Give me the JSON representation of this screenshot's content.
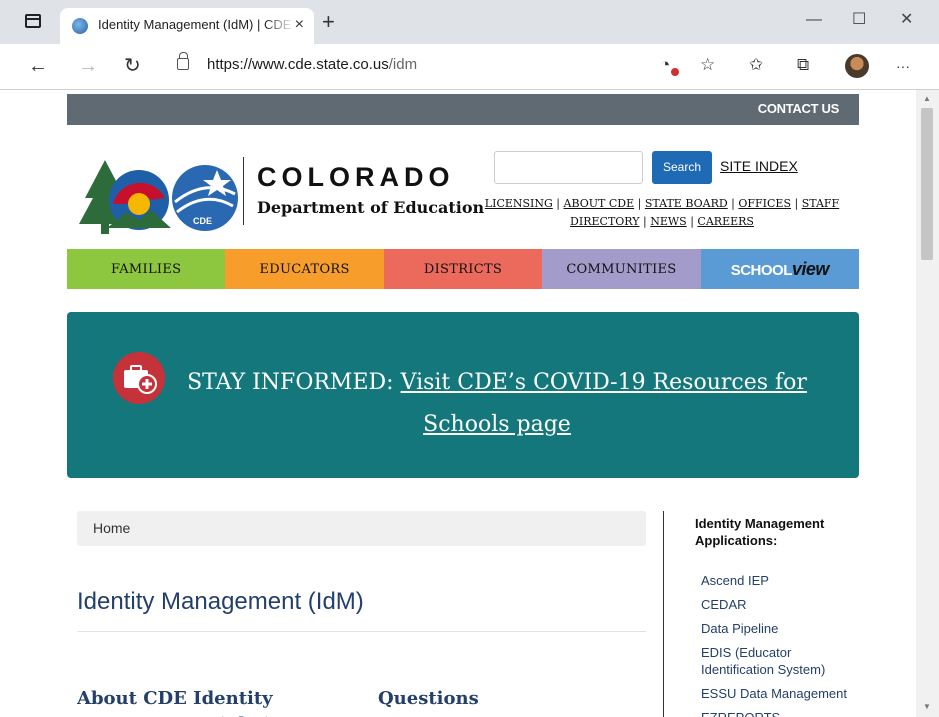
{
  "browser": {
    "tab_title": "Identity Management (IdM) | CDE",
    "close_glyph": "×",
    "new_tab_glyph": "+",
    "minimize_glyph": "—",
    "maximize_glyph": "☐",
    "window_close_glyph": "✕",
    "url_host": "https://www.cde.state.co.us",
    "url_path": "/idm",
    "back_glyph": "←",
    "forward_glyph": "→",
    "reload_glyph": "↻",
    "more_glyph": "···"
  },
  "header": {
    "contact_us": "CONTACT US",
    "colorado": "COLORADO",
    "department": "Department of Education",
    "search_placeholder": "",
    "search_button": "Search",
    "site_index": "SITE INDEX",
    "links": {
      "licensing": "LICENSING",
      "about": "ABOUT CDE",
      "state_board": "STATE BOARD",
      "offices": "OFFICES",
      "staff_directory": "STAFF DIRECTORY",
      "news": "NEWS",
      "careers": "CAREERS"
    },
    "logo_badge": "CDE"
  },
  "nav": {
    "families": "FAMILIES",
    "educators": "EDUCATORS",
    "districts": "DISTRICTS",
    "communities": "COMMUNITIES",
    "schoolview_a": "SCHOOL",
    "schoolview_b": "view"
  },
  "colors": {
    "families": "#8dc63f",
    "educators": "#f79d2c",
    "districts": "#ec6a5c",
    "communities": "#a39bc9",
    "schoolview": "#5b9bd5",
    "banner": "#14777c",
    "top_strip": "#5f6a72"
  },
  "banner": {
    "prefix": "STAY INFORMED: ",
    "link": "Visit CDE’s COVID-19 Resources for Schools page"
  },
  "main": {
    "breadcrumb": "Home",
    "title": "Identity Management (IdM)",
    "col1_head": "About CDE Identity Management (IdM)",
    "col2_head": "Questions"
  },
  "sidebar": {
    "heading": "Identity Management Applications:",
    "items": [
      "Ascend IEP",
      "CEDAR",
      "Data Pipeline",
      "EDIS (Educator Identification System)",
      "ESSU Data Management",
      "EZREPORTS"
    ]
  }
}
